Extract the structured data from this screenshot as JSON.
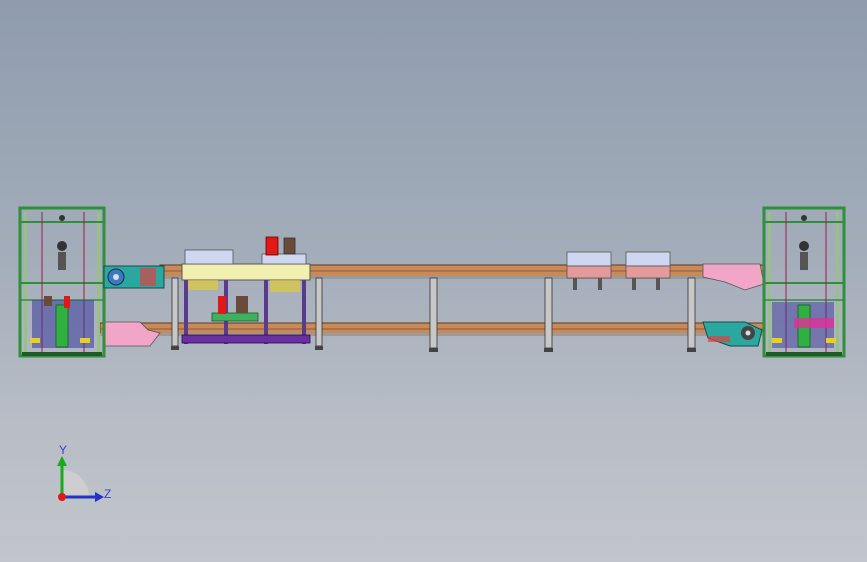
{
  "viewport": {
    "background_top": "#8f9cae",
    "background_bottom": "#c2c5cb"
  },
  "model": {
    "description_colors": {
      "frame_green": "#2f8f3a",
      "rail_brown": "#c98a5a",
      "support_grey": "#c8c8c8",
      "carrier_purple": "#6a2fa0",
      "cylinder_red": "#e01818",
      "pink_panel": "#f1a6c8",
      "teal_motor": "#2aa8a0",
      "yellow_plate": "#f2f0b0"
    }
  },
  "triad": {
    "y_label": "Y",
    "z_label": "Z",
    "y_color": "#1aaa1a",
    "z_color": "#2233cc",
    "origin_color": "#e01818"
  }
}
